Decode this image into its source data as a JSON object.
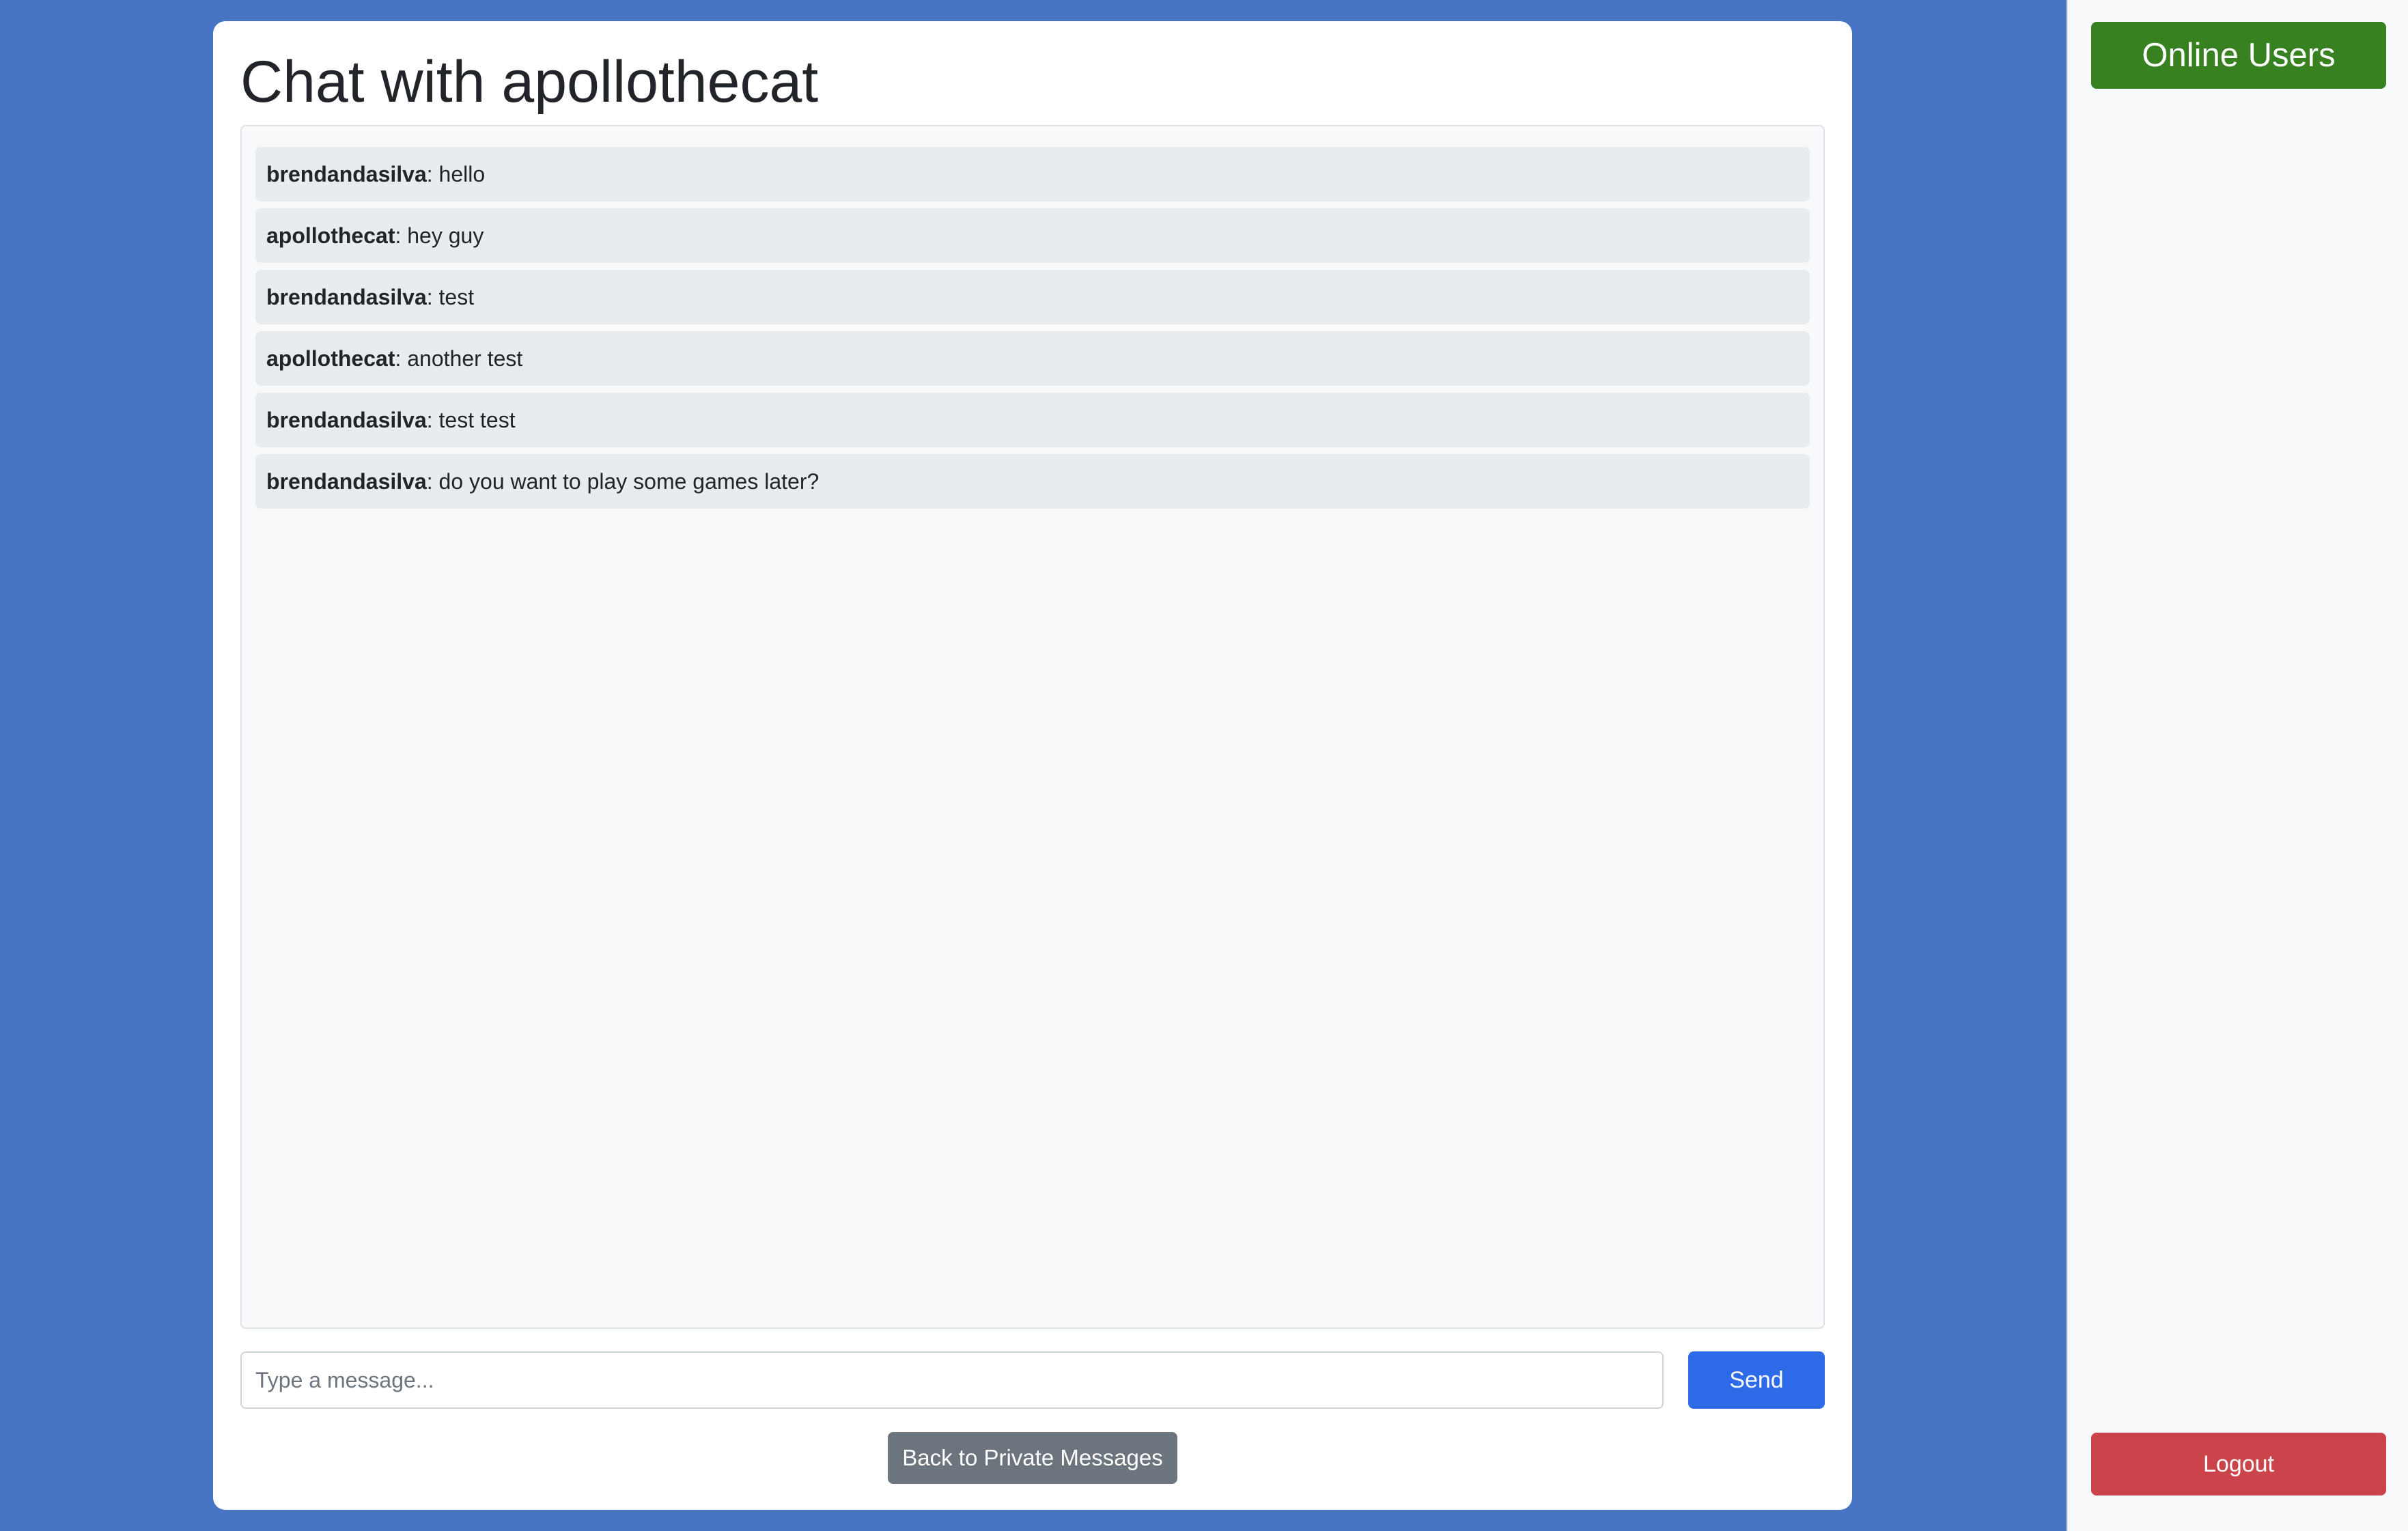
{
  "chat": {
    "title": "Chat with apollothecat",
    "messages": [
      {
        "sender": "brendandasilva",
        "separator": ": ",
        "text": "hello"
      },
      {
        "sender": "apollothecat",
        "separator": ": ",
        "text": "hey guy"
      },
      {
        "sender": "brendandasilva",
        "separator": ": ",
        "text": "test"
      },
      {
        "sender": "apollothecat",
        "separator": ": ",
        "text": "another test"
      },
      {
        "sender": "brendandasilva",
        "separator": ": ",
        "text": "test test"
      },
      {
        "sender": "brendandasilva",
        "separator": ": ",
        "text": "do you want to play some games later?"
      }
    ],
    "input": {
      "value": "",
      "placeholder": "Type a message..."
    },
    "send_label": "Send",
    "back_label": "Back to Private Messages"
  },
  "sidebar": {
    "online_users_label": "Online Users",
    "logout_label": "Logout"
  },
  "colors": {
    "page_background": "#4874c4",
    "send_button": "#2d6ae8",
    "back_button": "#6c757d",
    "online_users_button": "#378120",
    "logout_button": "#cb444b",
    "message_background": "#e9ecef"
  }
}
